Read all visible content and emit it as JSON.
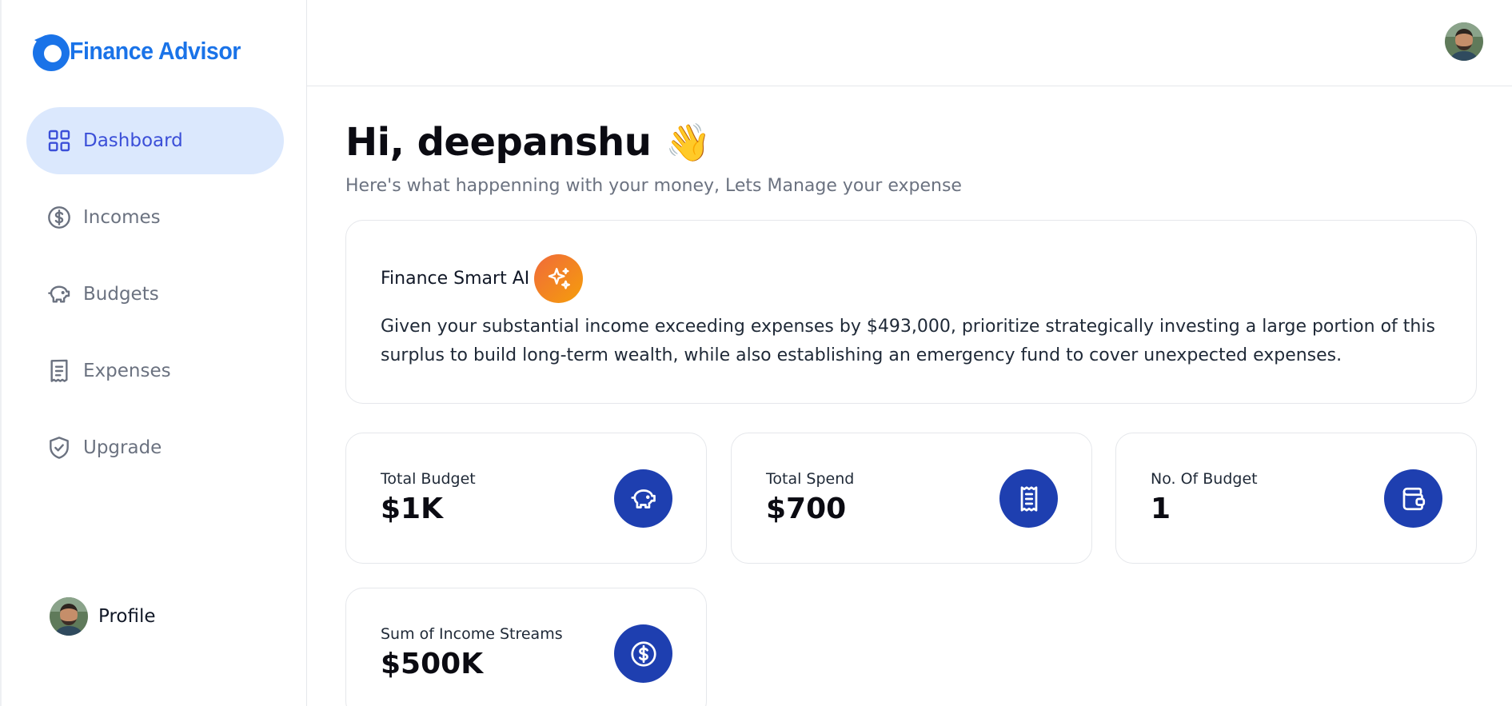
{
  "app": {
    "name": "Finance Advisor"
  },
  "sidebar": {
    "items": [
      {
        "label": "Dashboard",
        "icon": "grid-icon",
        "active": true
      },
      {
        "label": "Incomes",
        "icon": "dollar-circle-icon",
        "active": false
      },
      {
        "label": "Budgets",
        "icon": "piggy-bank-icon",
        "active": false
      },
      {
        "label": "Expenses",
        "icon": "receipt-icon",
        "active": false
      },
      {
        "label": "Upgrade",
        "icon": "shield-check-icon",
        "active": false
      }
    ],
    "profile_label": "Profile"
  },
  "header": {
    "greeting": "Hi, deepanshu",
    "wave_emoji": "👋",
    "subtitle": "Here's what happenning with your money, Lets Manage your expense"
  },
  "ai_card": {
    "title": "Finance Smart AI",
    "message": "Given your substantial income exceeding expenses by $493,000, prioritize strategically investing a large portion of this surplus to build long-term wealth, while also establishing an emergency fund to cover unexpected expenses."
  },
  "stats": [
    {
      "label": "Total Budget",
      "value": "$1K",
      "icon": "piggy-bank-icon"
    },
    {
      "label": "Total Spend",
      "value": "$700",
      "icon": "receipt-icon"
    },
    {
      "label": "No. Of Budget",
      "value": "1",
      "icon": "wallet-icon"
    },
    {
      "label": "Sum of Income Streams",
      "value": "$500K",
      "icon": "dollar-circle-icon"
    }
  ],
  "colors": {
    "brand": "#1a73e8",
    "active_nav_bg": "#dbe8fd",
    "active_nav_text": "#3b4fd8",
    "stat_icon_bg": "#1e3fb0",
    "ai_badge_start": "#f06a3a",
    "ai_badge_end": "#f59e0b"
  }
}
